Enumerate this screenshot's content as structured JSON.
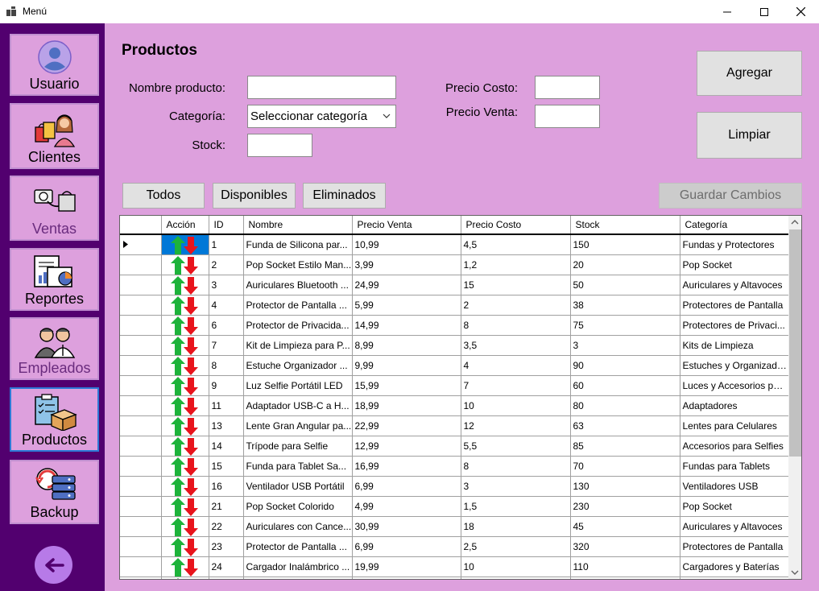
{
  "window": {
    "title": "Menú"
  },
  "sidebar": {
    "items": [
      {
        "label": "Usuario"
      },
      {
        "label": "Clientes"
      },
      {
        "label": "Ventas"
      },
      {
        "label": "Reportes"
      },
      {
        "label": "Empleados"
      },
      {
        "label": "Productos"
      },
      {
        "label": "Backup"
      }
    ]
  },
  "form": {
    "title": "Productos",
    "nombre_label": "Nombre producto:",
    "nombre_value": "",
    "categoria_label": "Categoría:",
    "categoria_value": "Seleccionar categoría",
    "stock_label": "Stock:",
    "stock_value": "",
    "precio_costo_label": "Precio Costo:",
    "precio_costo_value": "",
    "precio_venta_label": "Precio Venta:",
    "precio_venta_value": ""
  },
  "buttons": {
    "agregar": "Agregar",
    "limpiar": "Limpiar",
    "todos": "Todos",
    "disponibles": "Disponibles",
    "eliminados": "Eliminados",
    "guardar": "Guardar Cambios"
  },
  "grid": {
    "columns": [
      "Acción",
      "ID",
      "Nombre",
      "Precio Venta",
      "Precio Costo",
      "Stock",
      "Categoría"
    ],
    "rows": [
      {
        "id": "1",
        "nombre": "Funda de Silicona par...",
        "venta": "10,99",
        "costo": "4,5",
        "stock": "150",
        "categoria": "Fundas y Protectores"
      },
      {
        "id": "2",
        "nombre": "Pop Socket Estilo Man...",
        "venta": "3,99",
        "costo": "1,2",
        "stock": "20",
        "categoria": "Pop Socket"
      },
      {
        "id": "3",
        "nombre": "Auriculares Bluetooth ...",
        "venta": "24,99",
        "costo": "15",
        "stock": "50",
        "categoria": "Auriculares y Altavoces"
      },
      {
        "id": "4",
        "nombre": "Protector de Pantalla ...",
        "venta": "5,99",
        "costo": "2",
        "stock": "38",
        "categoria": "Protectores de Pantalla"
      },
      {
        "id": "6",
        "nombre": "Protector de Privacida...",
        "venta": "14,99",
        "costo": "8",
        "stock": "75",
        "categoria": "Protectores de Privaci..."
      },
      {
        "id": "7",
        "nombre": "Kit de Limpieza para P...",
        "venta": "8,99",
        "costo": "3,5",
        "stock": "3",
        "categoria": "Kits de Limpieza"
      },
      {
        "id": "8",
        "nombre": "Estuche Organizador ...",
        "venta": "9,99",
        "costo": "4",
        "stock": "90",
        "categoria": "Estuches y Organizado..."
      },
      {
        "id": "9",
        "nombre": "Luz Selfie Portátil LED",
        "venta": "15,99",
        "costo": "7",
        "stock": "60",
        "categoria": "Luces y Accesorios par..."
      },
      {
        "id": "11",
        "nombre": "Adaptador USB-C a H...",
        "venta": "18,99",
        "costo": "10",
        "stock": "80",
        "categoria": "Adaptadores"
      },
      {
        "id": "13",
        "nombre": "Lente Gran Angular pa...",
        "venta": "22,99",
        "costo": "12",
        "stock": "63",
        "categoria": "Lentes para Celulares"
      },
      {
        "id": "14",
        "nombre": "Trípode para Selfie",
        "venta": "12,99",
        "costo": "5,5",
        "stock": "85",
        "categoria": "Accesorios para Selfies"
      },
      {
        "id": "15",
        "nombre": "Funda para Tablet Sa...",
        "venta": "16,99",
        "costo": "8",
        "stock": "70",
        "categoria": "Fundas para Tablets"
      },
      {
        "id": "16",
        "nombre": "Ventilador USB Portátil",
        "venta": "6,99",
        "costo": "3",
        "stock": "130",
        "categoria": "Ventiladores USB"
      },
      {
        "id": "21",
        "nombre": "Pop Socket Colorido",
        "venta": "4,99",
        "costo": "1,5",
        "stock": "230",
        "categoria": "Pop Socket"
      },
      {
        "id": "22",
        "nombre": "Auriculares con Cance...",
        "venta": "30,99",
        "costo": "18",
        "stock": "45",
        "categoria": "Auriculares y Altavoces"
      },
      {
        "id": "23",
        "nombre": "Protector de Pantalla ...",
        "venta": "6,99",
        "costo": "2,5",
        "stock": "320",
        "categoria": "Protectores de Pantalla"
      },
      {
        "id": "24",
        "nombre": "Cargador Inalámbrico ...",
        "venta": "19,99",
        "costo": "10",
        "stock": "110",
        "categoria": "Cargadores y Baterías"
      },
      {
        "id": "",
        "nombre": "",
        "venta": "",
        "costo": "",
        "stock": "",
        "categoria": ""
      }
    ]
  },
  "colors": {
    "background": "#dda0dd",
    "sidebar": "#52006f",
    "selection": "#0078d7",
    "arrow_up": "#1db33a",
    "arrow_down": "#e8141c"
  }
}
